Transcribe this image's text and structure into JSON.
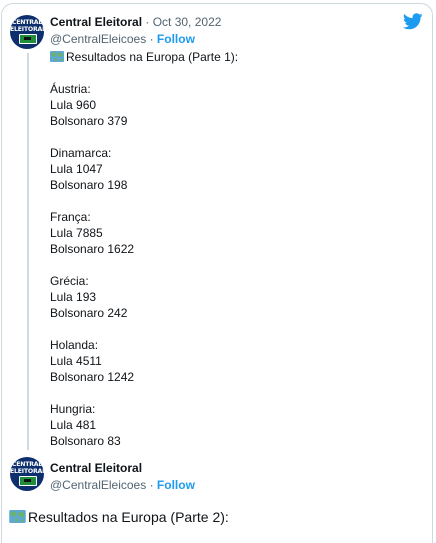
{
  "tweet1": {
    "author_name": "Central Eleitoral",
    "separator": " · ",
    "date": "Oct 30, 2022",
    "handle": "@CentralEleicoes",
    "follow_label": "Follow",
    "avatar_text": "CENTRAL ELEITORAL",
    "intro": "Resultados na Europa (Parte 1):",
    "map_icon": "world-map-emoji",
    "results": [
      {
        "country": "Áustria:",
        "lula": "Lula 960",
        "bolsonaro": "Bolsonaro 379"
      },
      {
        "country": "Dinamarca:",
        "lula": "Lula 1047",
        "bolsonaro": "Bolsonaro 198"
      },
      {
        "country": "França:",
        "lula": "Lula 7885",
        "bolsonaro": "Bolsonaro 1622"
      },
      {
        "country": "Grécia:",
        "lula": "Lula 193",
        "bolsonaro": "Bolsonaro 242"
      },
      {
        "country": "Holanda:",
        "lula": "Lula 4511",
        "bolsonaro": "Bolsonaro 1242"
      },
      {
        "country": "Hungria:",
        "lula": "Lula 481",
        "bolsonaro": "Bolsonaro 83"
      }
    ]
  },
  "tweet2": {
    "author_name": "Central Eleitoral",
    "handle": "@CentralEleicoes",
    "separator": " · ",
    "follow_label": "Follow",
    "avatar_text": "CENTRAL ELEITORAL",
    "text": "Resultados na Europa (Parte 2):",
    "map_icon": "world-map-emoji"
  },
  "colors": {
    "twitter_blue": "#1d9bf0",
    "secondary_text": "#536471",
    "avatar_bg": "#0d2f6e"
  }
}
